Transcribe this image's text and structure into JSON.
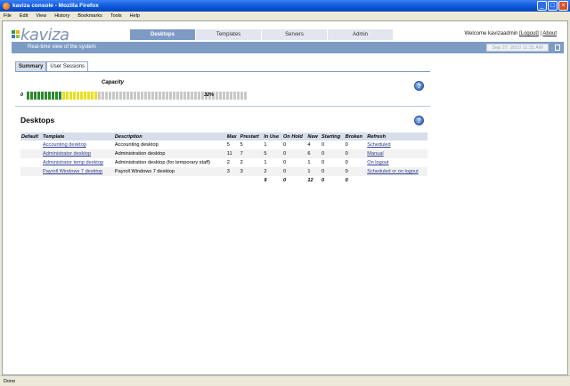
{
  "window": {
    "title": "kaviza console - Mozilla Firefox",
    "buttons": [
      "_",
      "□",
      "×"
    ]
  },
  "menubar": [
    "File",
    "Edit",
    "View",
    "History",
    "Bookmarks",
    "Tools",
    "Help"
  ],
  "brand": {
    "logo_text": "kaviza",
    "logo_colors": [
      "#2e9e3a",
      "#f0b21a",
      "#3a7ad8",
      "#9bc53d"
    ]
  },
  "nav": {
    "tabs": [
      "Desktops",
      "Templates",
      "Servers",
      "Admin"
    ],
    "active": "Desktops"
  },
  "welcome": {
    "prefix": "Welcome kavizaadmin ",
    "logout": "[Logout]",
    "sep": " | ",
    "about": "About"
  },
  "banner": {
    "text": "Real-time view of the system",
    "date": "Sep 27, 2010 11:31 AM"
  },
  "subtabs": [
    "Summary",
    "User Sessions"
  ],
  "capacity": {
    "label": "Capacity",
    "min_label": "0",
    "percent_label": "32%",
    "percent": 32,
    "segments_total": 62,
    "segments_green": 10,
    "segments_yellow": 10,
    "colors": {
      "green": "#2d8a2d",
      "yellow": "#e8e020",
      "empty": "#c8c8c8"
    }
  },
  "desktops": {
    "title": "Desktops",
    "columns": [
      "Default",
      "Template",
      "Description",
      "Max",
      "Prestart",
      "In Use",
      "On Hold",
      "New",
      "Starting",
      "Broken",
      "Refresh"
    ],
    "rows": [
      [
        "",
        "Accounting desktop",
        "Accounting desktop",
        "5",
        "5",
        "1",
        "0",
        "4",
        "0",
        "0",
        "Scheduled"
      ],
      [
        "",
        "Administrator desktop",
        "Administration desktop",
        "11",
        "7",
        "5",
        "0",
        "6",
        "0",
        "0",
        "Manual"
      ],
      [
        "",
        "Administrator temp desktop",
        "Administration desktop (for temporary staff)",
        "2",
        "2",
        "1",
        "0",
        "1",
        "0",
        "0",
        "On logout"
      ],
      [
        "",
        "Payroll Windows 7 desktop",
        "Payroll Windows 7 desktop",
        "3",
        "3",
        "2",
        "0",
        "1",
        "0",
        "0",
        "Scheduled or on logout"
      ]
    ],
    "totals": [
      "",
      "",
      "",
      "",
      "",
      "9",
      "0",
      "12",
      "0",
      "0",
      ""
    ]
  },
  "help_icon": "?",
  "statusbar": {
    "text": "Done"
  }
}
